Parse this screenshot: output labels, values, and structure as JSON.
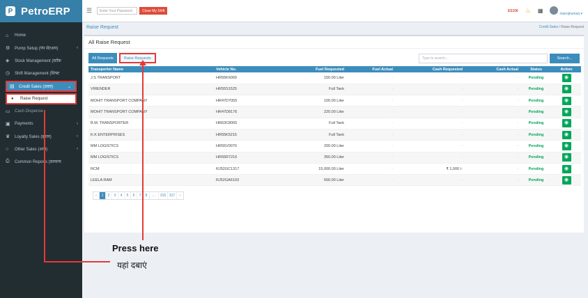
{
  "brand": {
    "logo_letter": "P",
    "name": "PetroERP"
  },
  "sidebar": {
    "items": [
      {
        "icon": "home-icon",
        "glyph": "⌂",
        "label": "Home",
        "arrow": ""
      },
      {
        "icon": "cogs-icon",
        "glyph": "⚙",
        "label": "Pump Setup (पंप सेटअप)",
        "arrow": "‹"
      },
      {
        "icon": "cubes-icon",
        "glyph": "◈",
        "label": "Stock Management (स्टॉक",
        "arrow": ""
      },
      {
        "icon": "clock-icon",
        "glyph": "◷",
        "label": "Shift Management (शिफ्ट",
        "arrow": ""
      },
      {
        "icon": "credit-card-icon",
        "glyph": "▤",
        "label": "Credit Sales (उधार)",
        "arrow": "⌄"
      },
      {
        "icon": "dot-icon",
        "glyph": "●",
        "label": "Raise Request",
        "arrow": ""
      },
      {
        "icon": "money-icon",
        "glyph": "▭",
        "label": "Cash Dispense",
        "arrow": ""
      },
      {
        "icon": "payments-icon",
        "glyph": "▣",
        "label": "Payments",
        "arrow": "‹"
      },
      {
        "icon": "trophy-icon",
        "glyph": "♛",
        "label": "Loyalty Sales (इनाम)",
        "arrow": "‹"
      },
      {
        "icon": "circle-icon",
        "glyph": "○",
        "label": "Other Sales (अन्य)",
        "arrow": "‹"
      },
      {
        "icon": "print-icon",
        "glyph": "⎙",
        "label": "Common Reports (सामान्य",
        "arrow": ""
      }
    ]
  },
  "header": {
    "password_placeholder": "Enter Your Password",
    "close_shift": "Close My Shift",
    "code": "ES106",
    "user": "manojkumarj ▾"
  },
  "page": {
    "title": "Raise Request",
    "breadcrumb_parent": "Credit Sales",
    "breadcrumb_sep": "/",
    "breadcrumb_current": "Raise Request"
  },
  "card": {
    "title": "All Raise Request",
    "tab_all": "All Requests",
    "tab_raise": "Raise Requests",
    "search_placeholder": "Type to search....",
    "search_button": "Search..."
  },
  "table": {
    "headers": [
      "Transporter Name",
      "Vehicle No.",
      "Fuel Requested",
      "Fuel Actual",
      "Cash Requested",
      "Cash Actual",
      "Status",
      "Action"
    ],
    "rows": [
      [
        "J.S TRANSPORT",
        "HR55K6069",
        "150.00 Liter",
        "-",
        "-",
        "-",
        "Pending"
      ],
      [
        "VIRENDER",
        "HR55S1525",
        "Full Tank",
        "-",
        "-",
        "-",
        "Pending"
      ],
      [
        "MOHIT TRANSPORT COMPANY",
        "HR47D7055",
        "100.00 Liter",
        "-",
        "-",
        "-",
        "Pending"
      ],
      [
        "MOHIT TRANSPORT COMPANY",
        "HR47D8176",
        "220.00 Liter",
        "-",
        "-",
        "-",
        "Pending"
      ],
      [
        "B.M. TRANSPORTER",
        "HR63C8065",
        "Full Tank",
        "-",
        "-",
        "-",
        "Pending"
      ],
      [
        "K.K ENTERPRISES",
        "HR55K5215",
        "Full Tank",
        "-",
        "-",
        "-",
        "Pending"
      ],
      [
        "MM LOGISTICS",
        "HR55V0070",
        "200.00 Liter",
        "-",
        "-",
        "-",
        "Pending"
      ],
      [
        "MM LOGISTICS",
        "HR55R7216",
        "350.00 Liter",
        "-",
        "-",
        "-",
        "Pending"
      ],
      [
        "RCM",
        "RJ52GC1317",
        "15,000.00 Liter",
        "-",
        "₹ 1,000 /-",
        "-",
        "Pending"
      ],
      [
        "LEELA RAM",
        "RJ52GA6193",
        "500.00 Liter",
        "-",
        "-",
        "-",
        "Pending"
      ]
    ],
    "action_icon": "eye-icon"
  },
  "pagination": {
    "pages": [
      "‹",
      "1",
      "2",
      "3",
      "4",
      "5",
      "6",
      "7",
      "8",
      "...",
      "316",
      "317",
      "›"
    ],
    "active": "1"
  },
  "annotation": {
    "text_en": "Press here",
    "text_hi": "यहां दबाएं",
    "color": "#e53935"
  }
}
